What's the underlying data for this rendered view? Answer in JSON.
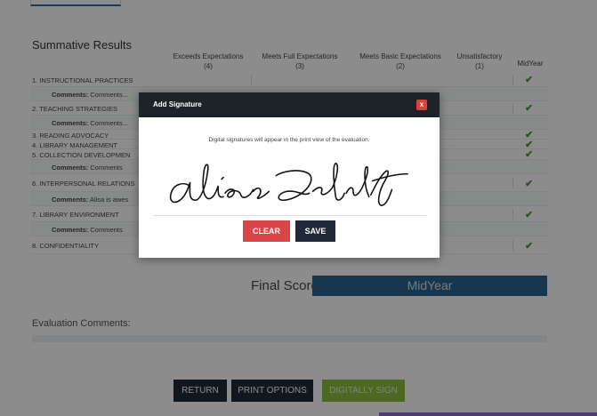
{
  "section_title": "Summative Results",
  "columns": [
    {
      "name": "Exceeds Expectations",
      "level": "(4)"
    },
    {
      "name": "Meets Full Expectations",
      "level": "(3)"
    },
    {
      "name": "Meets Basic Expectations",
      "level": "(2)"
    },
    {
      "name": "Unsatisfactory",
      "level": "(1)"
    }
  ],
  "midyear_header": "MidYear",
  "rows": [
    {
      "label": "1. Instructional Practices",
      "check": "✔"
    },
    {
      "comment_key": "Comments:",
      "comment_val": "Comments..."
    },
    {
      "label": "2. Teaching Strategies",
      "check": "✔"
    },
    {
      "comment_key": "Comments:",
      "comment_val": "Comments..."
    },
    {
      "label": "3. Reading Advocacy",
      "check": "✔"
    },
    {
      "label": "4. Library Management",
      "check": "✔"
    },
    {
      "label": "5. Collection Developmen",
      "check": "✔"
    },
    {
      "comment_key": "Comments:",
      "comment_val": "Comments"
    },
    {
      "label": "6. Interpersonal Relations",
      "check": "✔"
    },
    {
      "comment_key": "Comments:",
      "comment_val": "Alisa is awes"
    },
    {
      "label": "7. Library Environment",
      "check": "✔"
    },
    {
      "comment_key": "Comments:",
      "comment_val": "Comments"
    },
    {
      "label": "8. Confidentiality",
      "check": "✔"
    }
  ],
  "final_score_label": "Final Score:",
  "final_score_value": "MidYear",
  "evaluation_comments_label": "Evaluation Comments:",
  "buttons": {
    "return": "RETURN",
    "print_options": "PRINT OPTIONS",
    "digitally_sign": "DIGITALLY SIGN"
  },
  "modal": {
    "title": "Add Signature",
    "close": "x",
    "note": "Digital signatures will appear in the print view of the evaluation.",
    "clear": "CLEAR",
    "save": "SAVE"
  },
  "colors": {
    "accent": "#2c6590",
    "check": "#4a9b3a",
    "sign": "#8bbd3e",
    "clear": "#d9464a",
    "dark": "#1f2a36"
  }
}
